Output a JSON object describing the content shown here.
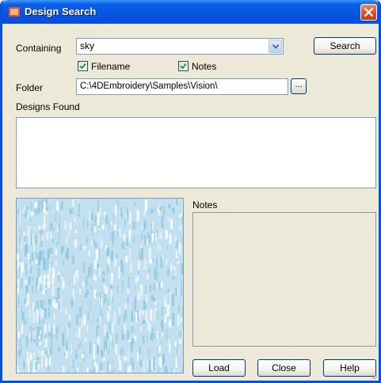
{
  "window": {
    "title": "Design Search"
  },
  "search": {
    "containing_label": "Containing",
    "containing_value": "sky",
    "search_button": "Search",
    "filename_label": "Filename",
    "filename_checked": true,
    "notes_check_label": "Notes",
    "notes_checked": true,
    "folder_label": "Folder",
    "folder_value": "C:\\4DEmbroidery\\Samples\\Vision\\",
    "browse_button": "..."
  },
  "results": {
    "designs_found_label": "Designs Found",
    "items": []
  },
  "notes": {
    "label": "Notes",
    "value": ""
  },
  "buttons": {
    "load": "Load",
    "close": "Close",
    "help": "Help"
  },
  "colors": {
    "titlebar": "#0a4fd8",
    "dialog_bg": "#ece9d8",
    "close_button": "#d9522b",
    "preview_base": "#c2e0ef",
    "preview_thread": "#8ec6e0",
    "checkmark": "#21a121"
  },
  "icons": {
    "title": "app-icon-4d",
    "close": "close-icon",
    "dropdown": "chevron-down-icon",
    "check": "check-icon"
  }
}
